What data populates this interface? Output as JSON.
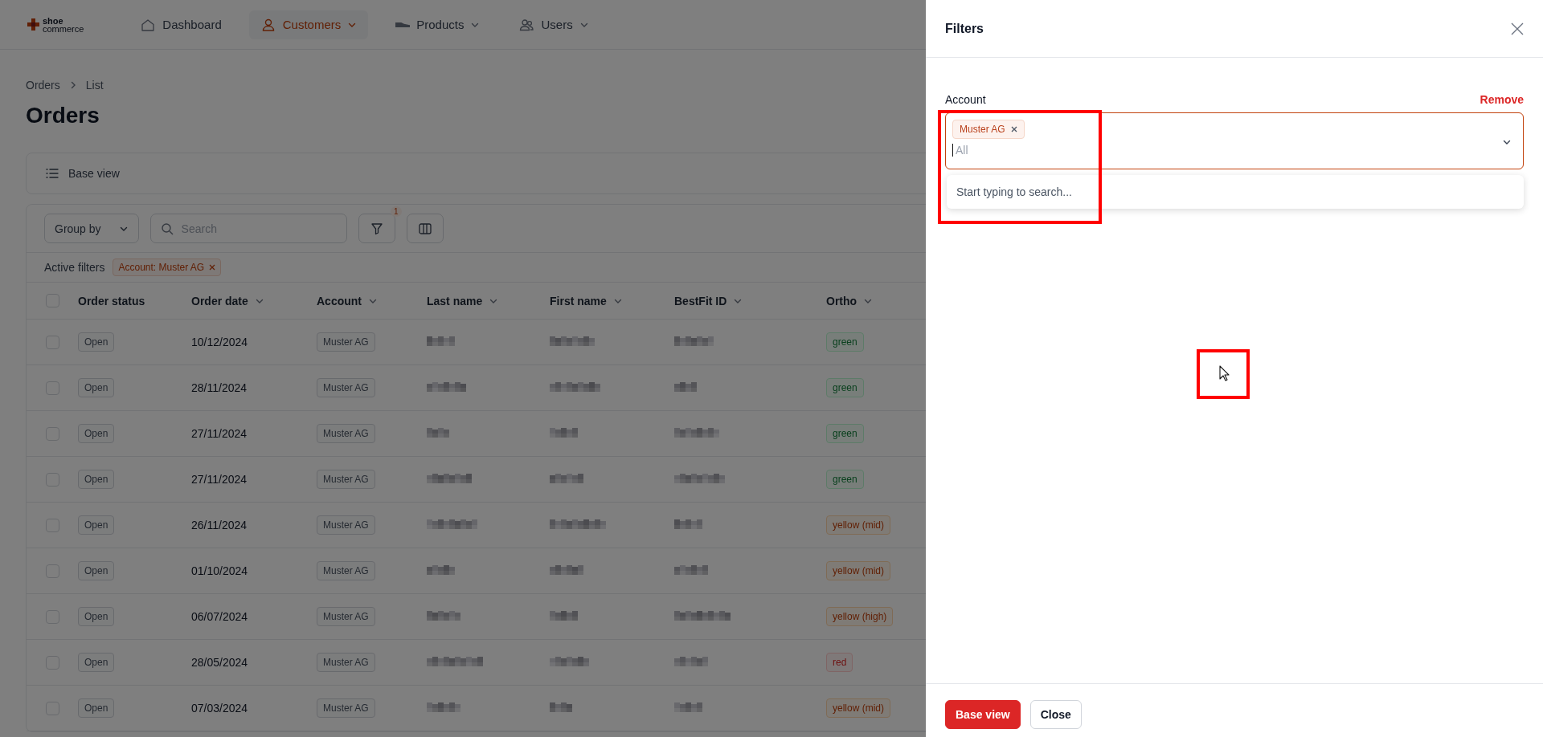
{
  "nav": {
    "logo": [
      "shoe",
      "commerce"
    ],
    "items": [
      {
        "label": "Dashboard",
        "dropdown": false,
        "selected": false
      },
      {
        "label": "Customers",
        "dropdown": true,
        "selected": true
      },
      {
        "label": "Products",
        "dropdown": true,
        "selected": false
      },
      {
        "label": "Users",
        "dropdown": true,
        "selected": false
      }
    ]
  },
  "breadcrumb": [
    "Orders",
    "List"
  ],
  "title": "Orders",
  "view": {
    "label": "Base view"
  },
  "toolbar": {
    "group_by": "Group by",
    "search_placeholder": "Search",
    "filter_count": "1"
  },
  "active_filters": {
    "label": "Active filters",
    "tags": [
      "Account: Muster AG"
    ]
  },
  "table": {
    "header_checked": false,
    "columns": [
      {
        "label": "Order status",
        "sortable": false
      },
      {
        "label": "Order date",
        "sortable": true
      },
      {
        "label": "Account",
        "sortable": true
      },
      {
        "label": "Last name",
        "sortable": true
      },
      {
        "label": "First name",
        "sortable": true
      },
      {
        "label": "BestFit ID",
        "sortable": true
      },
      {
        "label": "Ortho",
        "sortable": true
      }
    ],
    "rows": [
      {
        "checked": false,
        "status": "Open",
        "date": "10/12/2024",
        "account": "Muster AG",
        "ortho": {
          "label": "green",
          "kind": "success"
        }
      },
      {
        "checked": false,
        "status": "Open",
        "date": "28/11/2024",
        "account": "Muster AG",
        "ortho": {
          "label": "green",
          "kind": "success"
        }
      },
      {
        "checked": false,
        "status": "Open",
        "date": "27/11/2024",
        "account": "Muster AG",
        "ortho": {
          "label": "green",
          "kind": "success"
        }
      },
      {
        "checked": false,
        "status": "Open",
        "date": "27/11/2024",
        "account": "Muster AG",
        "ortho": {
          "label": "green",
          "kind": "success"
        }
      },
      {
        "checked": false,
        "status": "Open",
        "date": "26/11/2024",
        "account": "Muster AG",
        "ortho": {
          "label": "yellow (mid)",
          "kind": "warning"
        }
      },
      {
        "checked": false,
        "status": "Open",
        "date": "01/10/2024",
        "account": "Muster AG",
        "ortho": {
          "label": "yellow (mid)",
          "kind": "warning"
        }
      },
      {
        "checked": false,
        "status": "Open",
        "date": "06/07/2024",
        "account": "Muster AG",
        "ortho": {
          "label": "yellow (high)",
          "kind": "warning"
        }
      },
      {
        "checked": false,
        "status": "Open",
        "date": "28/05/2024",
        "account": "Muster AG",
        "ortho": {
          "label": "red",
          "kind": "danger"
        }
      },
      {
        "checked": false,
        "status": "Open",
        "date": "07/03/2024",
        "account": "Muster AG",
        "ortho": {
          "label": "yellow (mid)",
          "kind": "warning"
        }
      }
    ]
  },
  "panel": {
    "title": "Filters",
    "filter": {
      "label": "Account",
      "remove": "Remove",
      "tags": [
        "Muster AG"
      ],
      "placeholder": "All",
      "dropdown_hint": "Start typing to search..."
    },
    "buttons": [
      {
        "label": "Base view",
        "kind": "primary"
      },
      {
        "label": "Close",
        "kind": "secondary"
      }
    ]
  }
}
